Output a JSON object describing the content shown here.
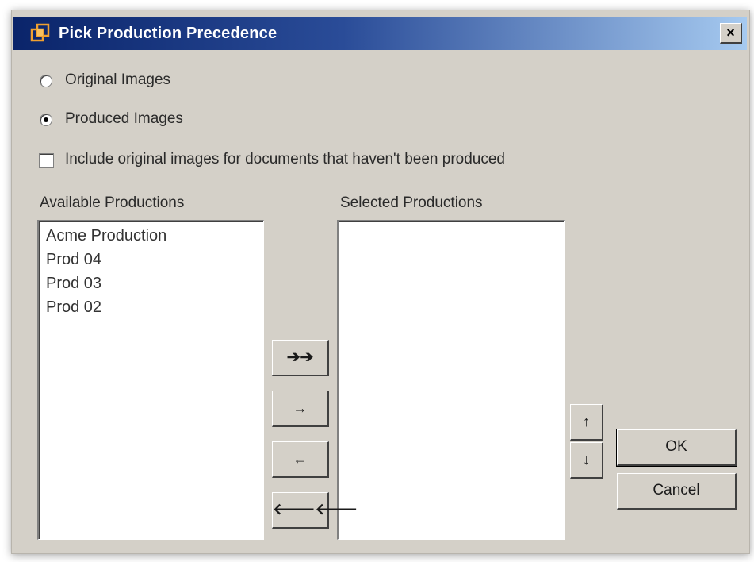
{
  "window": {
    "title": "Pick Production Precedence",
    "close_label": "×"
  },
  "options": {
    "original_images_label": "Original Images",
    "original_images_selected": false,
    "produced_images_label": "Produced Images",
    "produced_images_selected": true,
    "include_original_label": "Include original images for documents that haven't been produced",
    "include_original_checked": false
  },
  "available": {
    "header": "Available Productions",
    "items": [
      "Acme Production",
      "Prod 04",
      "Prod 03",
      "Prod 02"
    ]
  },
  "selected": {
    "header": "Selected Productions",
    "items": []
  },
  "transfer_buttons": {
    "add_all": "➔➔",
    "add": "→",
    "remove": "←",
    "remove_all": "🡐🡐"
  },
  "order_buttons": {
    "up": "↑",
    "down": "↓"
  },
  "actions": {
    "ok": "OK",
    "cancel": "Cancel"
  },
  "colors": {
    "titlebar_start": "#0a246a",
    "titlebar_end": "#a6caf0",
    "dialog_bg": "#d4d0c8"
  }
}
